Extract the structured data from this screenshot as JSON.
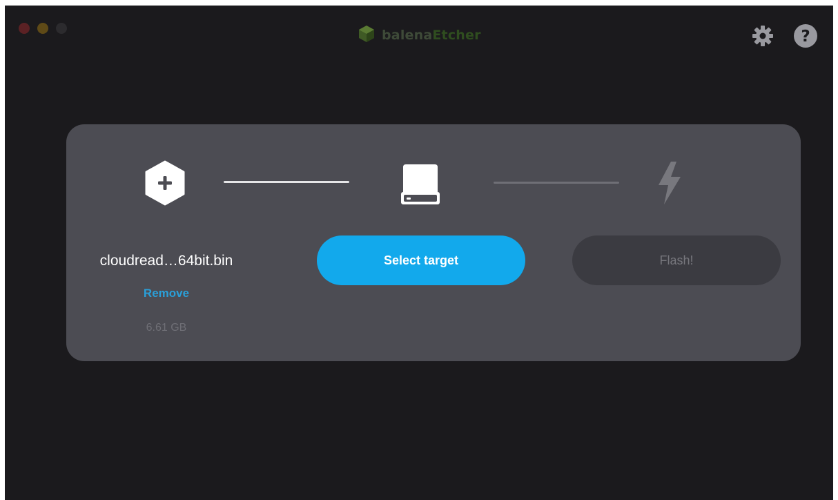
{
  "window": {
    "traffic_lights": [
      "close",
      "minimize",
      "maximize"
    ]
  },
  "header": {
    "brand_part1": "balena",
    "brand_part2": "Etcher",
    "logo_icon": "cube-icon",
    "settings_icon": "gear-icon",
    "help_icon": "question-icon"
  },
  "steps": {
    "image": {
      "icon": "hexagon-plus-icon",
      "filename": "cloudread…64bit.bin",
      "remove_label": "Remove",
      "size": "6.61 GB"
    },
    "target": {
      "icon": "drive-icon",
      "button_label": "Select target"
    },
    "flash": {
      "icon": "lightning-icon",
      "button_label": "Flash!"
    }
  },
  "colors": {
    "background": "#1b1a1d",
    "panel": "#4c4c53",
    "accent": "#12a9ec",
    "link": "#2a9fd8",
    "brand_green": "#2f4d1f"
  }
}
